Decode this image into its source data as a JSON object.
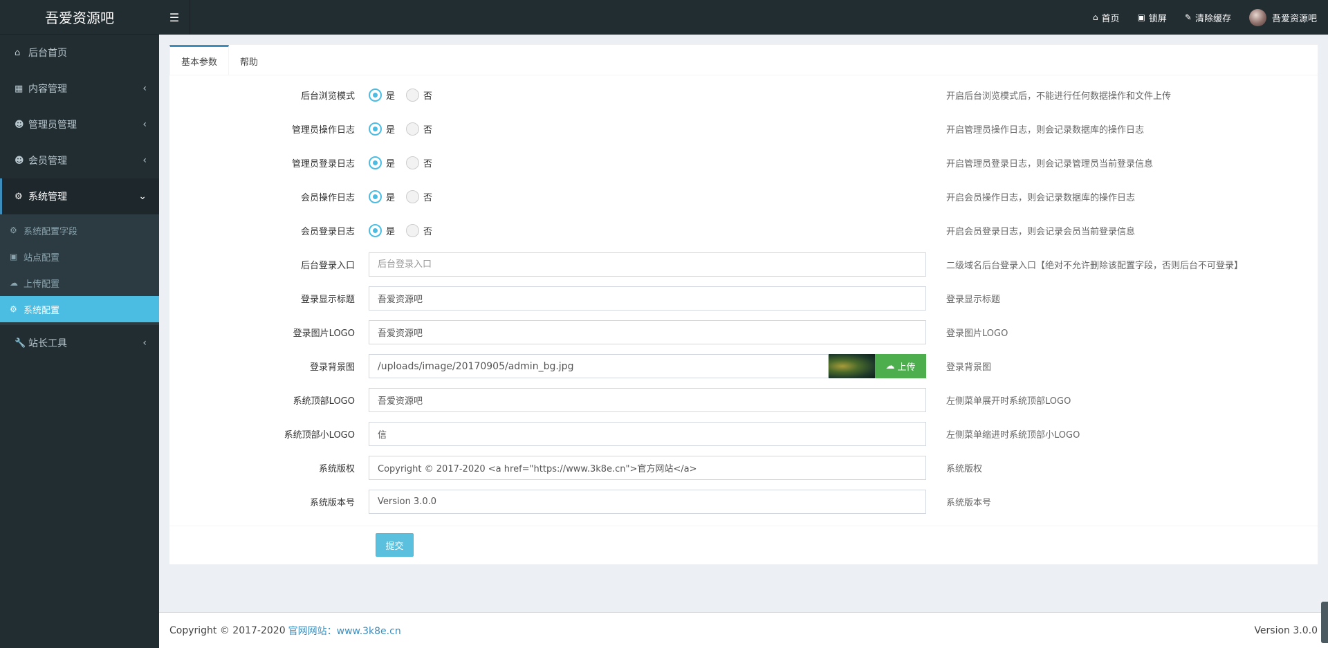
{
  "app": {
    "logo": "吾爱资源吧"
  },
  "sidebar": {
    "items": [
      {
        "label": "后台首页",
        "icon": "home-icon",
        "chevron": false
      },
      {
        "label": "内容管理",
        "icon": "th-icon",
        "chevron": true
      },
      {
        "label": "管理员管理",
        "icon": "users-icon",
        "chevron": true
      },
      {
        "label": "会员管理",
        "icon": "users-icon",
        "chevron": true
      },
      {
        "label": "系统管理",
        "icon": "gear-icon",
        "chevron": true,
        "active": true
      },
      {
        "label": "站长工具",
        "icon": "wrench-icon",
        "chevron": true
      }
    ],
    "submenu": [
      {
        "label": "系统配置字段",
        "icon": "cogs-icon"
      },
      {
        "label": "站点配置",
        "icon": "desktop-icon"
      },
      {
        "label": "上传配置",
        "icon": "cloud-upload-icon"
      },
      {
        "label": "系统配置",
        "icon": "gear-icon",
        "active": true
      }
    ]
  },
  "header": {
    "nav": [
      {
        "label": "首页",
        "icon": "home-icon"
      },
      {
        "label": "锁屏",
        "icon": "desktop-icon"
      },
      {
        "label": "清除缓存",
        "icon": "brush-icon"
      }
    ],
    "user": "吾爱资源吧"
  },
  "tabs": [
    "基本参数",
    "帮助"
  ],
  "radio_labels": {
    "yes": "是",
    "no": "否"
  },
  "form": {
    "rows": [
      {
        "label": "后台浏览模式",
        "type": "radio",
        "value": "是",
        "help": "开启后台浏览模式后，不能进行任何数据操作和文件上传"
      },
      {
        "label": "管理员操作日志",
        "type": "radio",
        "value": "是",
        "help": "开启管理员操作日志，则会记录数据库的操作日志"
      },
      {
        "label": "管理员登录日志",
        "type": "radio",
        "value": "是",
        "help": "开启管理员登录日志，则会记录管理员当前登录信息"
      },
      {
        "label": "会员操作日志",
        "type": "radio",
        "value": "是",
        "help": "开启会员操作日志，则会记录数据库的操作日志"
      },
      {
        "label": "会员登录日志",
        "type": "radio",
        "value": "是",
        "help": "开启会员登录日志，则会记录会员当前登录信息"
      },
      {
        "label": "后台登录入口",
        "type": "text",
        "value": "",
        "placeholder": "后台登录入口",
        "help": "二级域名后台登录入口【绝对不允许删除该配置字段，否则后台不可登录】"
      },
      {
        "label": "登录显示标题",
        "type": "text",
        "value": "吾爱资源吧",
        "help": "登录显示标题"
      },
      {
        "label": "登录图片LOGO",
        "type": "text",
        "value": "吾爱资源吧",
        "help": "登录图片LOGO"
      },
      {
        "label": "登录背景图",
        "type": "upload",
        "value": "/uploads/image/20170905/admin_bg.jpg",
        "button": "上传",
        "help": "登录背景图"
      },
      {
        "label": "系统顶部LOGO",
        "type": "text",
        "value": "吾爱资源吧",
        "help": "左侧菜单展开时系统顶部LOGO"
      },
      {
        "label": "系统顶部小LOGO",
        "type": "text",
        "value": "信",
        "help": "左侧菜单缩进时系统顶部小LOGO"
      },
      {
        "label": "系统版权",
        "type": "text",
        "value": "Copyright © 2017-2020 <a href=\"https://www.3k8e.cn\">官方网站</a>",
        "help": "系统版权"
      },
      {
        "label": "系统版本号",
        "type": "text",
        "value": "Version 3.0.0",
        "help": "系统版本号"
      }
    ],
    "submit": "提交"
  },
  "footer": {
    "copyright": "Copyright © 2017-2020",
    "link": "官网网站：www.3k8e.cn",
    "version": "Version 3.0.0"
  },
  "colors": {
    "sidebar": "#222d32",
    "accent": "#4bbce2",
    "upload": "#4cae4c"
  }
}
